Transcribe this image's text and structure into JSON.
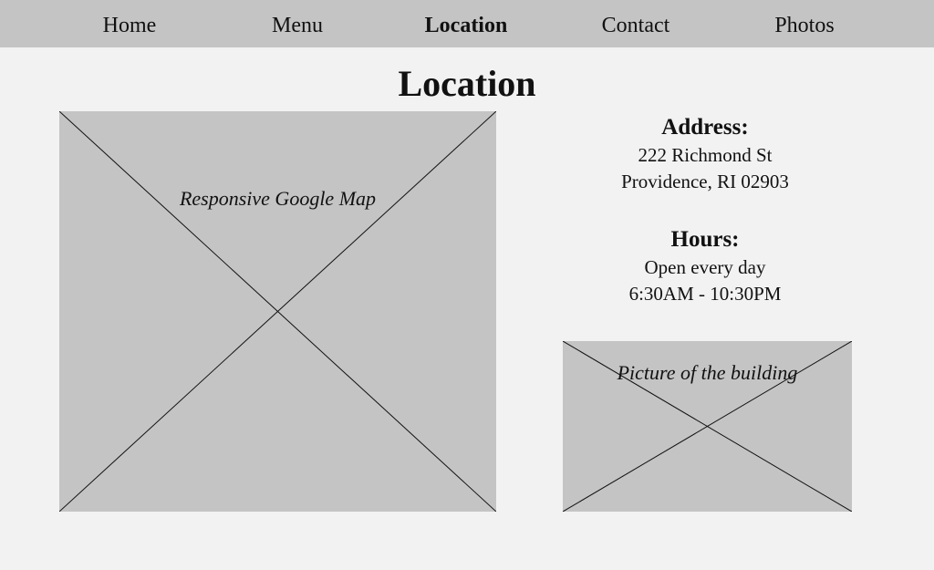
{
  "nav": {
    "items": [
      {
        "label": "Home"
      },
      {
        "label": "Menu"
      },
      {
        "label": "Location",
        "active": true
      },
      {
        "label": "Contact"
      },
      {
        "label": "Photos"
      }
    ]
  },
  "page": {
    "title": "Location"
  },
  "map": {
    "label": "Responsive Google Map"
  },
  "address": {
    "heading": "Address:",
    "line1": "222 Richmond St",
    "line2": "Providence, RI 02903"
  },
  "hours": {
    "heading": "Hours:",
    "line1": "Open every day",
    "line2": "6:30AM - 10:30PM"
  },
  "building": {
    "label": "Picture of the building"
  },
  "colors": {
    "navbar": "#c4c4c4",
    "background": "#f2f2f2",
    "placeholder": "#c4c4c4"
  }
}
